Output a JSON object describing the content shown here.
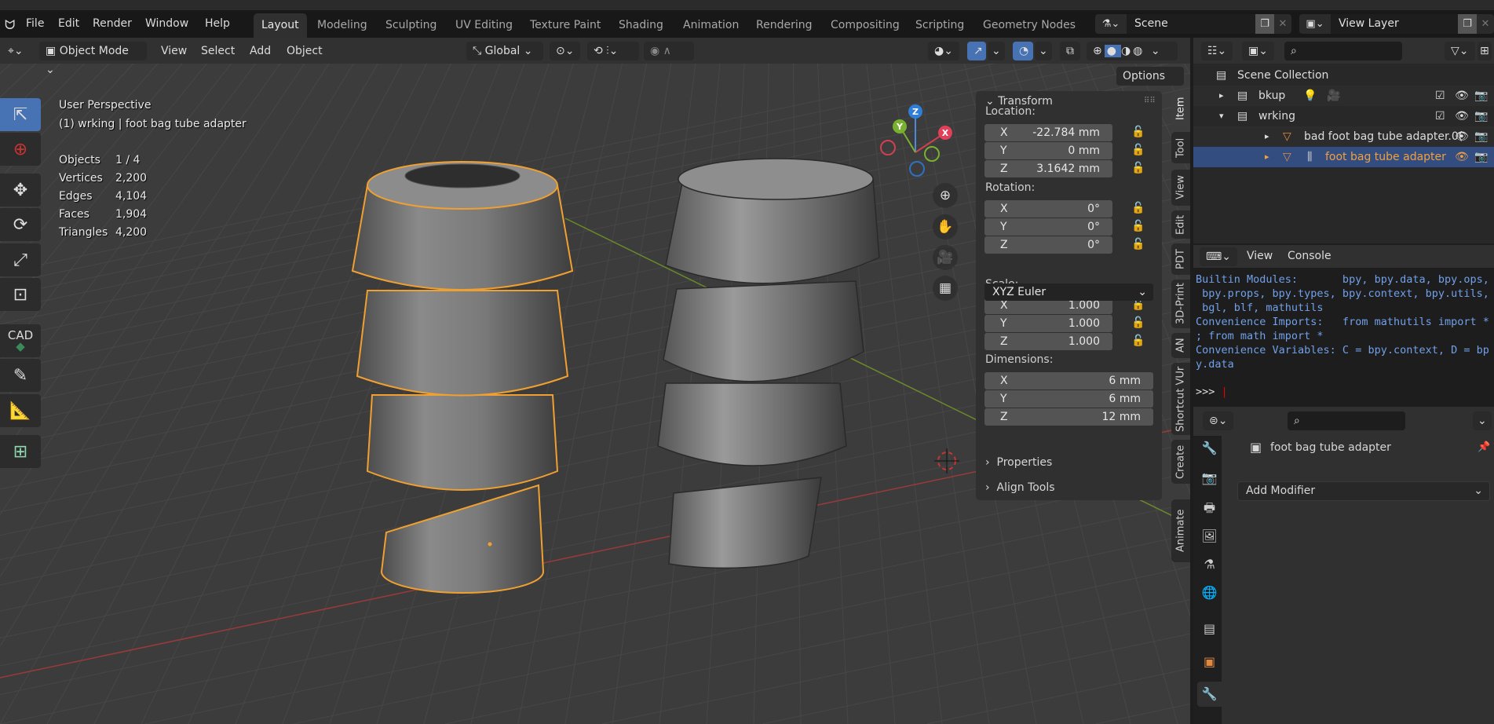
{
  "topbar": {
    "menus": [
      "File",
      "Edit",
      "Render",
      "Window",
      "Help"
    ],
    "workspaces": [
      "Layout",
      "Modeling",
      "Sculpting",
      "UV Editing",
      "Texture Paint",
      "Shading",
      "Animation",
      "Rendering",
      "Compositing",
      "Scripting",
      "Geometry Nodes"
    ],
    "active_workspace": "Layout",
    "scene": "Scene",
    "view_layer": "View Layer"
  },
  "viewport": {
    "mode": "Object Mode",
    "menus": [
      "View",
      "Select",
      "Add",
      "Object"
    ],
    "orientation": "Global",
    "options_label": "Options",
    "overlay": {
      "perspective": "User Perspective",
      "context": "(1) wrking | foot bag tube adapter"
    },
    "stats": [
      {
        "label": "Objects",
        "value": "1 / 4"
      },
      {
        "label": "Vertices",
        "value": "2,200"
      },
      {
        "label": "Edges",
        "value": "4,104"
      },
      {
        "label": "Faces",
        "value": "1,904"
      },
      {
        "label": "Triangles",
        "value": "4,200"
      }
    ],
    "gizmo": {
      "x": "X",
      "y": "Y",
      "z": "Z"
    },
    "tools_cad_label": "CAD",
    "accent_color": "#4772b3",
    "selection_color": "#f0a030"
  },
  "npanel": {
    "transform_title": "Transform",
    "location_label": "Location:",
    "location": [
      {
        "axis": "X",
        "value": "-22.784 mm"
      },
      {
        "axis": "Y",
        "value": "0 mm"
      },
      {
        "axis": "Z",
        "value": "3.1642 mm"
      }
    ],
    "rotation_label": "Rotation:",
    "rotation": [
      {
        "axis": "X",
        "value": "0°"
      },
      {
        "axis": "Y",
        "value": "0°"
      },
      {
        "axis": "Z",
        "value": "0°"
      }
    ],
    "rotation_mode": "XYZ Euler",
    "scale_label": "Scale:",
    "scale": [
      {
        "axis": "X",
        "value": "1.000"
      },
      {
        "axis": "Y",
        "value": "1.000"
      },
      {
        "axis": "Z",
        "value": "1.000"
      }
    ],
    "dimensions_label": "Dimensions:",
    "dimensions": [
      {
        "axis": "X",
        "value": "6 mm"
      },
      {
        "axis": "Y",
        "value": "6 mm"
      },
      {
        "axis": "Z",
        "value": "12 mm"
      }
    ],
    "properties_title": "Properties",
    "align_title": "Align Tools",
    "tabs": [
      "Item",
      "Tool",
      "View",
      "Edit",
      "PDT",
      "3D-Print",
      "AN",
      "Shortcut VUr",
      "Create",
      "Animate"
    ],
    "active_tab": "Item"
  },
  "outliner": {
    "root": "Scene Collection",
    "rows": [
      {
        "name": "bkup",
        "type": "collection"
      },
      {
        "name": "wrking",
        "type": "collection"
      },
      {
        "name": "bad foot bag tube adapter.0(",
        "type": "mesh"
      },
      {
        "name": "foot bag tube adapter",
        "type": "mesh",
        "selected": true
      }
    ]
  },
  "console": {
    "menus": [
      "View",
      "Console"
    ],
    "lines": [
      "Builtin Modules:       bpy, bpy.data, bpy.ops,",
      " bpy.props, bpy.types, bpy.context, bpy.utils,",
      " bgl, blf, mathutils",
      "Convenience Imports:   from mathutils import *",
      "; from math import *",
      "Convenience Variables: C = bpy.context, D = bp",
      "y.data"
    ],
    "prompt": ">>>"
  },
  "properties": {
    "object_name": "foot bag tube adapter",
    "add_modifier": "Add Modifier"
  }
}
